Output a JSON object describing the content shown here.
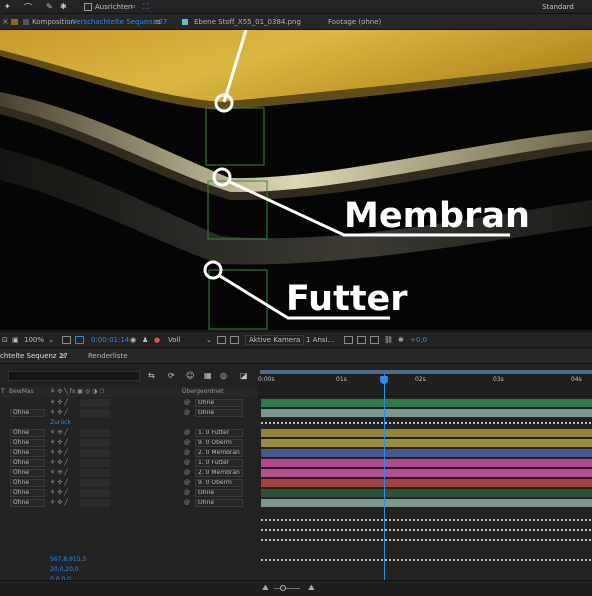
{
  "toolbar": {
    "align_label": "Ausrichten",
    "workspace": "Standard"
  },
  "tabs": {
    "composition_prefix": "Komposition",
    "composition_name": "Verschachtelte Sequenz 27",
    "menu_glyph": "≡",
    "layer_tab": "Ebene Stoff_X55_01_0384.png",
    "footage_tab": "Footage (ohne)"
  },
  "viewer": {
    "label_membran": "Membran",
    "label_futter": "Futter"
  },
  "viewer_controls": {
    "zoom": "100%",
    "timecode": "0:00:01:14",
    "resolution": "Voll",
    "camera": "Aktive Kamera",
    "views": "1 Ansi…",
    "exposure": "+0,0"
  },
  "timeline_tabs": {
    "sequence": "chtelte Sequenz 27",
    "menu_glyph": "≡",
    "render_queue": "Renderliste"
  },
  "columns": {
    "t": "T",
    "mode": "BewMas",
    "parent": "Übergeordnet"
  },
  "layers": [
    {
      "mode": "",
      "parent": "Ohne",
      "color": "#2e7a4a"
    },
    {
      "mode": "Ohne",
      "parent": "Ohne",
      "color": "#7d9690"
    },
    {
      "mode": "",
      "parent": "",
      "color": ""
    },
    {
      "mode": "Ohne",
      "parent": "1. 0 Futter",
      "color": "#8f8438"
    },
    {
      "mode": "Ohne",
      "parent": "9. 0 Oberm",
      "color": "#9a8c41"
    },
    {
      "mode": "Ohne",
      "parent": "2. 0 Membran",
      "color": "#48588e"
    },
    {
      "mode": "Ohne",
      "parent": "1. 0 Futter",
      "color": "#b2488d"
    },
    {
      "mode": "Ohne",
      "parent": "2. 0 Membran",
      "color": "#b6508f"
    },
    {
      "mode": "Ohne",
      "parent": "9. 0 Oberm",
      "color": "#a24241"
    },
    {
      "mode": "Ohne",
      "parent": "Ohne",
      "color": "#2c5238"
    },
    {
      "mode": "Ohne",
      "parent": "Ohne",
      "color": "#7d9690"
    }
  ],
  "group_label": "Zurück",
  "ruler": {
    "t0": "0:00s",
    "t1": "01s",
    "t2": "02s",
    "t3": "03s",
    "t4": "04s"
  },
  "bottom_info": {
    "position": "567,8,915,5",
    "scale": "20,0,20,0",
    "rotation": "0,0,0,0"
  },
  "colors": {
    "accent": "#2d8ceb",
    "gold": "#c9a431"
  }
}
